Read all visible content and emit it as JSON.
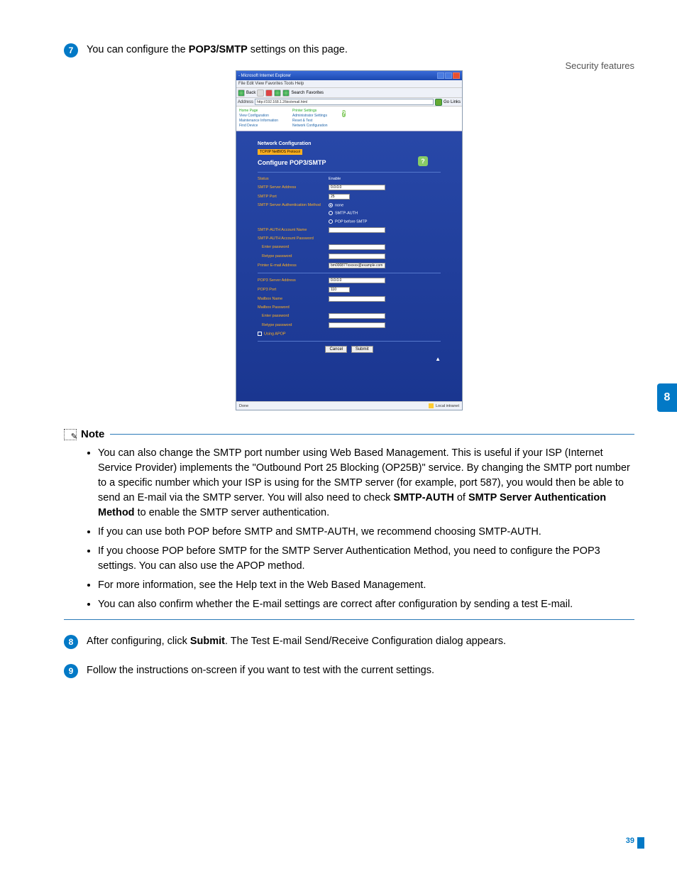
{
  "header": {
    "section": "Security features"
  },
  "side_tab": "8",
  "page_number": "39",
  "steps": {
    "s7": {
      "num": "7",
      "pre": "You can configure the ",
      "bold": "POP3/SMTP",
      "post": " settings on this page."
    },
    "s8": {
      "num": "8",
      "pre": "After configuring, click ",
      "bold": "Submit",
      "post": ". The Test E-mail Send/Receive Configuration dialog appears."
    },
    "s9": {
      "num": "9",
      "text": "Follow the instructions on-screen if you want to test with the current settings."
    }
  },
  "note": {
    "label": "Note",
    "b1_a": "You can also change the SMTP port number using Web Based Management. This is useful if your ISP (Internet Service Provider) implements the \"Outbound Port 25 Blocking (OP25B)\" service. By changing the SMTP port number to a specific number which your ISP is using for the SMTP server (for example, port 587), you would then be able to send an E-mail via the SMTP server. You will also need to check ",
    "b1_bold1": "SMTP-AUTH",
    "b1_mid": " of ",
    "b1_bold2": "SMTP Server Authentication Method",
    "b1_b": " to enable the SMTP server authentication.",
    "b2": "If you can use both POP before SMTP and SMTP-AUTH, we recommend choosing SMTP-AUTH.",
    "b3": "If you choose POP before SMTP for the SMTP Server Authentication Method, you need to configure the POP3 settings. You can also use the APOP method.",
    "b4": "For more information, see the Help text in the Web Based Management.",
    "b5": "You can also confirm whether the E-mail settings are correct after configuration by sending a test E-mail."
  },
  "ie": {
    "title_suffix": " - Microsoft Internet Explorer",
    "menu": "File  Edit  View  Favorites  Tools  Help",
    "back": "Back",
    "search": "Search",
    "favorites": "Favorites",
    "addr_label": "Address",
    "url": "http://192.168.1.2/bio/email.html",
    "go": "Go",
    "links": "Links",
    "done": "Done",
    "intranet": "Local intranet"
  },
  "nav": {
    "home": "Home Page",
    "view": "View Configuration",
    "maint": "Maintenance Information",
    "find": "Find Device",
    "printer": "Printer Settings",
    "admin": "Administrator Settings",
    "reset": "Reset & Test",
    "net": "Network Configuration"
  },
  "form": {
    "nc_title": "Network Configuration",
    "crumb": "TCP/IP NetBIOS Protocol",
    "section": "Configure POP3/SMTP",
    "status_l": "Status",
    "status_v": "Enable",
    "smtp_addr_l": "SMTP Server Address",
    "smtp_addr_v": "0.0.0.0",
    "smtp_port_l": "SMTP Port",
    "smtp_port_v": "25",
    "smtp_auth_l": "SMTP Server Authentication Method",
    "auth_none": "none",
    "auth_smtp": "SMTP-AUTH",
    "auth_pop": "POP before SMTP",
    "acct_l": "SMTP-AUTH Account Name",
    "pass_l": "SMTP-AUTH Account Password",
    "enter_pw": "Enter password",
    "retype_pw": "Retype password",
    "email_l": "Printer E-mail Address",
    "email_v": "bm000877xxxxxx@example.com",
    "pop_addr_l": "POP3 Server Address",
    "pop_addr_v": "0.0.0.0",
    "pop_port_l": "POP3 Port",
    "pop_port_v": "110",
    "mbox_l": "Mailbox Name",
    "mboxpw_l": "Mailbox Password",
    "apop": "Using APOP",
    "cancel": "Cancel",
    "submit": "Submit"
  }
}
